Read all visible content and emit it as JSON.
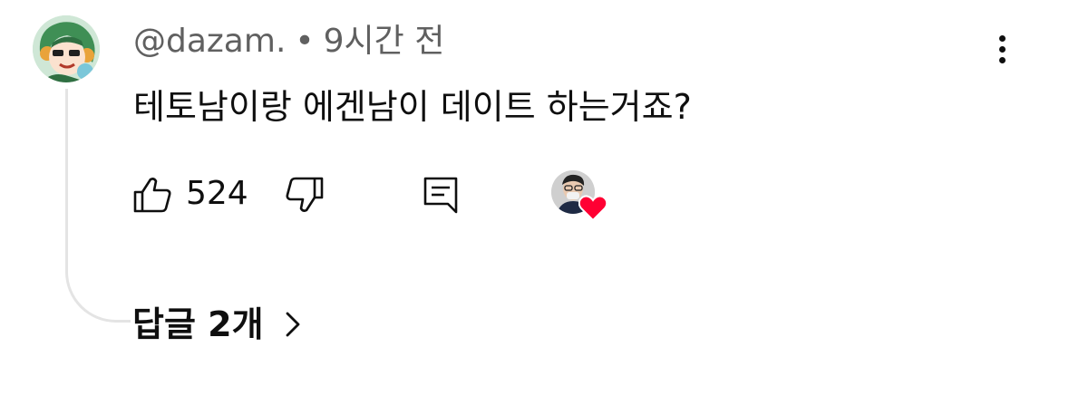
{
  "comment": {
    "username": "@dazam.",
    "separator": "•",
    "time": "9시간 전",
    "text": "테토남이랑 에겐남이 데이트 하는거죠?",
    "likes": "524",
    "replies_label": "답글 2개"
  },
  "icons": {
    "author_avatar": "anime-character-avatar-icon",
    "more": "more-vertical-icon",
    "like": "thumb-up-icon",
    "dislike": "thumb-down-icon",
    "reply": "comment-reply-icon",
    "creator_heart": "heart-icon",
    "replies_chevron": "chevron-right-icon"
  },
  "colors": {
    "text_primary": "#0f0f0f",
    "text_secondary": "#606060",
    "heart": "#ff0033",
    "thread_line": "#e4e4e4"
  }
}
